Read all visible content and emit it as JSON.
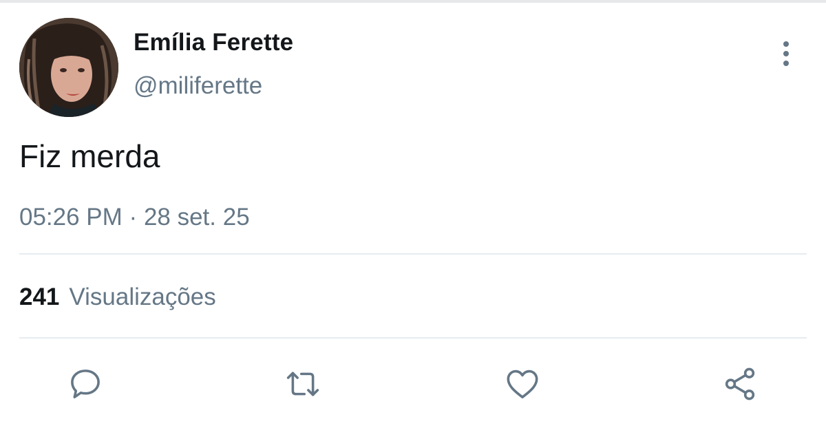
{
  "author": {
    "name": "Emília Ferette",
    "handle": "@miliferette",
    "avatar_icon": "profile-photo"
  },
  "tweet": {
    "text": "Fiz merda",
    "time": "05:26 PM",
    "separator": "·",
    "date": "28 set. 25"
  },
  "stats": {
    "views_count": "241",
    "views_label": "Visualizações"
  },
  "actions": {
    "reply_icon": "reply-icon",
    "retweet_icon": "retweet-icon",
    "like_icon": "heart-icon",
    "share_icon": "share-icon",
    "more_icon": "more-vertical-icon"
  },
  "colors": {
    "primary_text": "#14171a",
    "secondary_text": "#657786",
    "divider": "#e6ecf0",
    "icon": "#657786"
  }
}
